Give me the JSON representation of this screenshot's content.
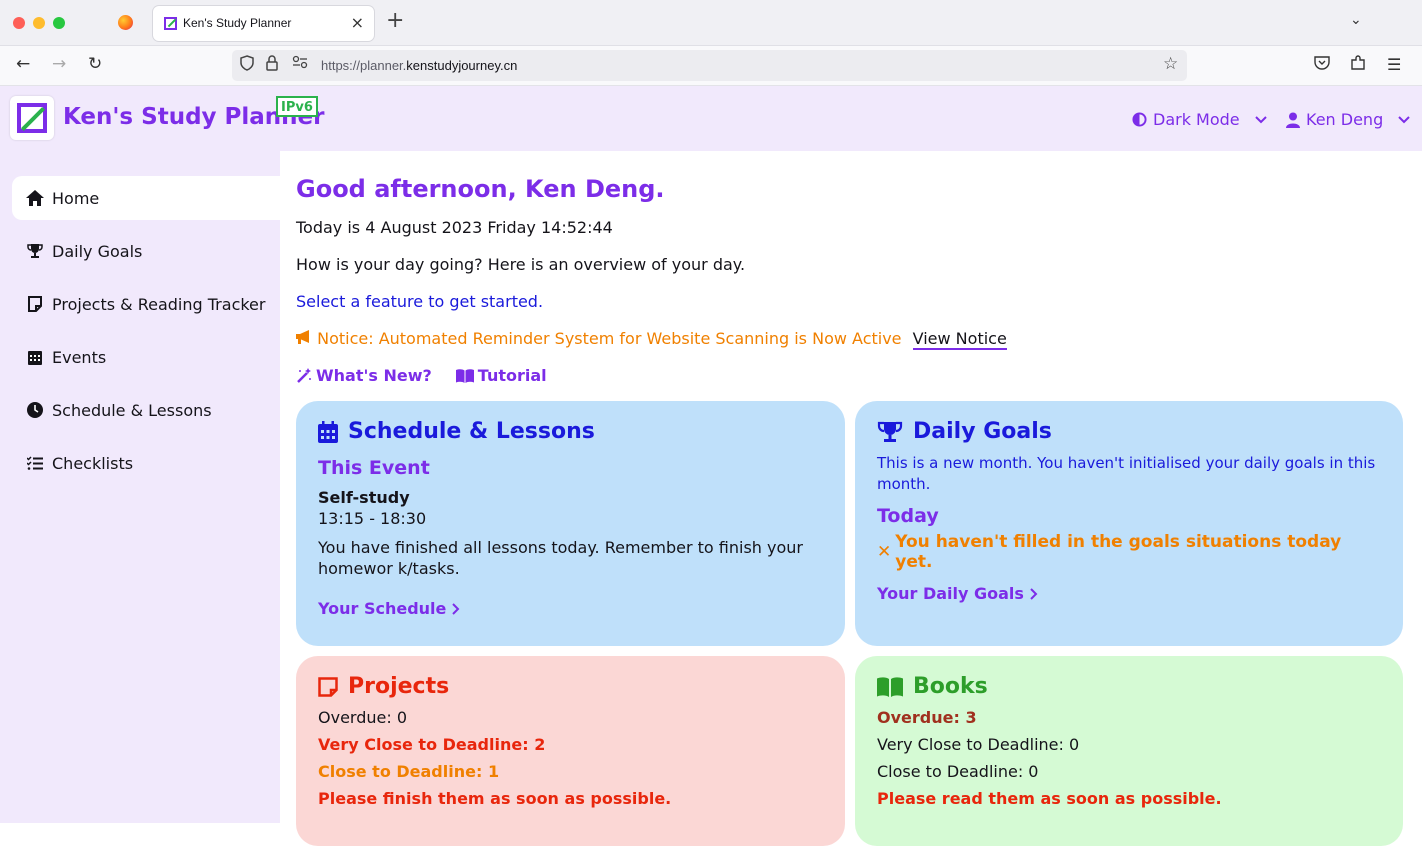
{
  "browser": {
    "tab_title": "Ken's Study Planner",
    "tab_close": "×",
    "new_tab": "+",
    "url_prefix": "https://planner.",
    "url_host": "kenstudyjourney.cn"
  },
  "header": {
    "brand": "Ken's Study Planner",
    "badge": "IPv6",
    "dark_mode_label": "Dark Mode",
    "user_label": "Ken Deng"
  },
  "sidebar": {
    "items": [
      {
        "label": "Home",
        "icon": "home-icon",
        "active": true
      },
      {
        "label": "Daily Goals",
        "icon": "trophy-icon"
      },
      {
        "label": "Projects & Reading Tracker",
        "icon": "note-icon"
      },
      {
        "label": "Events",
        "icon": "calendar-icon"
      },
      {
        "label": "Schedule & Lessons",
        "icon": "clock-icon"
      },
      {
        "label": "Checklists",
        "icon": "checklist-icon"
      }
    ]
  },
  "main": {
    "greeting": "Good afternoon, Ken Deng.",
    "today": "Today is 4 August 2023  Friday  14:52:44",
    "overview": "How is your day going? Here is an overview of your day.",
    "select_feature": "Select a feature to get started.",
    "notice": "Notice: Automated Reminder System for Website Scanning is Now Active",
    "view_notice": "View Notice",
    "whats_new": "What's New?",
    "tutorial": "Tutorial"
  },
  "schedule_card": {
    "title": "Schedule & Lessons",
    "subtitle": "This Event",
    "event_name": "Self-study",
    "event_time": "13:15 - 18:30",
    "message": "You have finished all lessons today. Remember to finish your homewor k/tasks.",
    "link": "Your Schedule"
  },
  "goals_card": {
    "title": "Daily Goals",
    "message": "This is a new month. You haven't initialised your daily goals in this month.",
    "subtitle": "Today",
    "warning": "You haven't filled in the goals situations today yet.",
    "link": "Your Daily Goals"
  },
  "projects_card": {
    "title": "Projects",
    "overdue": "Overdue: 0",
    "very_close": "Very Close to Deadline: 2",
    "close": "Close to Deadline: 1",
    "message": "Please finish them as soon as possible."
  },
  "books_card": {
    "title": "Books",
    "overdue": "Overdue: 3",
    "very_close": "Very Close to Deadline: 0",
    "close": "Close to Deadline: 0",
    "message": "Please read them as soon as possible."
  },
  "colors": {
    "accent": "#7c2de8",
    "green": "#2bb24c",
    "schedule_bg": "#bfe0fa",
    "projects_bg": "#fbd7d5",
    "books_bg": "#d5fad4",
    "warning_orange": "#f08000",
    "danger_red": "#e8260c"
  }
}
